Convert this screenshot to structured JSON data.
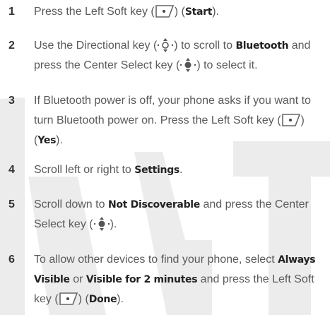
{
  "watermark_color": "#ececec",
  "text_color": "#5a5a5a",
  "steps": [
    {
      "number": "1",
      "t1": "Press the Left Soft key (",
      "icon1": "left-soft-key-icon",
      "t2": ") (",
      "b1": "Start",
      "t3": ")."
    },
    {
      "number": "2",
      "t1": "Use the Directional key (",
      "icon1": "directional-key-icon",
      "t2": ") to scroll to ",
      "b1": "Bluetooth",
      "t3": " and press the Center Select key (",
      "icon2": "center-select-key-icon",
      "t4": ") to select it."
    },
    {
      "number": "3",
      "t1": "If Bluetooth power is off, your phone asks if you want to turn Bluetooth power on. Press the Left Soft key (",
      "icon1": "left-soft-key-icon",
      "t2": ") (",
      "b1": "Yes",
      "t3": ")."
    },
    {
      "number": "4",
      "t1": "Scroll left or right to ",
      "b1": "Settings",
      "t2": "."
    },
    {
      "number": "5",
      "t1": "Scroll down to ",
      "b1": "Not Discoverable",
      "t2": " and press the Center Select key (",
      "icon1": "center-select-key-icon",
      "t3": ")."
    },
    {
      "number": "6",
      "t1": "To allow other devices to find your phone, select ",
      "b1": "Always Visible",
      "t2": " or ",
      "b2": "Visible for 2 minutes",
      "t3": " and press the Left Soft key (",
      "icon1": "left-soft-key-icon",
      "t4": ") (",
      "b3": "Done",
      "t5": ")."
    }
  ]
}
